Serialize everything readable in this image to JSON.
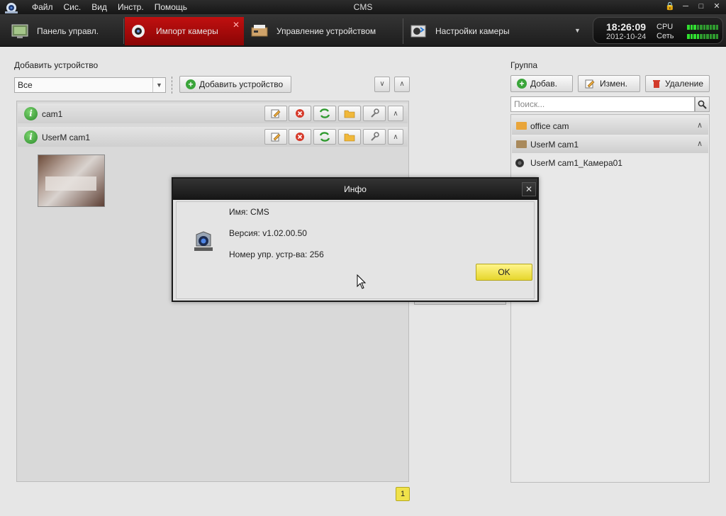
{
  "window": {
    "title": "CMS",
    "menu": [
      "Файл",
      "Сис.",
      "Вид",
      "Инстр.",
      "Помощь"
    ]
  },
  "tabs": [
    {
      "label": "Панель управл.",
      "icon": "control-panel-icon",
      "active": false
    },
    {
      "label": "Импорт камеры",
      "icon": "camera-import-icon",
      "active": true
    },
    {
      "label": "Управление устройством",
      "icon": "device-management-icon",
      "active": false
    },
    {
      "label": "Настройки камеры",
      "icon": "camera-settings-icon",
      "active": false
    }
  ],
  "status": {
    "time": "18:26:09",
    "date": "2012-10-24",
    "cpu_label": "CPU",
    "net_label": "Сеть"
  },
  "left": {
    "section_label": "Добавить устройство",
    "filter_value": "Все",
    "add_device_label": "Добавить устройство",
    "devices": [
      {
        "name": "cam1"
      },
      {
        "name": "UserM cam1"
      }
    ],
    "page": "1"
  },
  "right": {
    "section_label": "Группа",
    "add_label": "Добав.",
    "edit_label": "Измен.",
    "delete_label": "Удаление",
    "search_placeholder": "Поиск...",
    "groups": [
      {
        "name": "office cam"
      },
      {
        "name": "UserM cam1"
      }
    ],
    "cameras": [
      {
        "name": "UserM cam1_Камера01"
      }
    ]
  },
  "dialog": {
    "title": "Инфо",
    "name_label": "Имя:  CMS",
    "version_label": "Версия:  v1.02.00.50",
    "device_count_label": "Номер упр. устр-ва:  256",
    "ok_label": "OK"
  },
  "colors": {
    "active_tab": "#c11010",
    "ok_button": "#f0e24a",
    "add_green": "#3aa53a"
  }
}
